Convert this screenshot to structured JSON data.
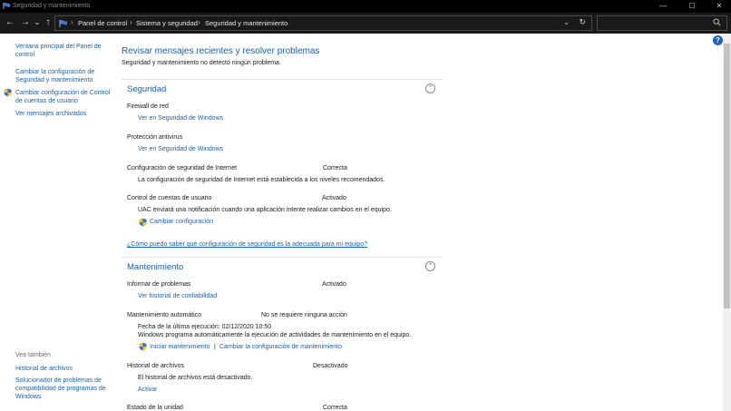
{
  "window": {
    "title": "Seguridad y mantenimiento",
    "minimize": "—",
    "maximize": "☐",
    "close": "✕"
  },
  "nav": {
    "back": "←",
    "forward": "→",
    "recent": "⌄",
    "up": "↑"
  },
  "breadcrumb": [
    "Panel de control",
    "Sistema y seguridad",
    "Seguridad y mantenimiento"
  ],
  "search": {
    "placeholder": ""
  },
  "sidebar": {
    "links": [
      "Ventana principal del Panel de control",
      "Cambiar la configuración de Seguridad y mantenimiento",
      "Cambiar configuración de Control de cuentas de usuario",
      "Ver mensajes archivados"
    ],
    "see_also_heading": "Vea también",
    "see_also": [
      "Historial de archivos",
      "Solucionador de problemas de compatibilidad de programas de Windows"
    ]
  },
  "header": {
    "title": "Revisar mensajes recientes y resolver problemas",
    "subtitle": "Seguridad y mantenimiento no detectó ningún problema."
  },
  "security": {
    "title": "Seguridad",
    "firewall": {
      "label": "Firewall de red",
      "link": "Ver en Seguridad de Windows"
    },
    "antivirus": {
      "label": "Protección antivirus",
      "link": "Ver en Seguridad de Windows"
    },
    "internet": {
      "label": "Configuración de seguridad de Internet",
      "status": "Correcta",
      "desc": "La configuración de seguridad de Internet está establecida a los niveles recomendados."
    },
    "uac": {
      "label": "Control de cuentas de usuario",
      "status": "Activado",
      "desc": "UAC enviará una notificación cuando una aplicación intente realizar cambios en el equipo.",
      "link": "Cambiar configuración"
    },
    "question_link": "¿Cómo puedo saber qué configuración de seguridad es la adecuada para mi equipo?"
  },
  "maintenance": {
    "title": "Mantenimiento",
    "problems": {
      "label": "Informar de problemas",
      "status": "Activado",
      "link": "Ver historial de confiabilidad"
    },
    "automatic": {
      "label": "Mantenimiento automático",
      "status": "No se requiere ninguna acción",
      "last_run": "Fecha de la última ejecución: 02/12/2020 10:50",
      "desc": "Windows programa automáticamente la ejecución de actividades de mantenimiento en el equipo.",
      "start_link": "Iniciar mantenimiento",
      "separator": "|",
      "change_link": "Cambiar la configuración de mantenimiento"
    },
    "file_history": {
      "label": "Historial de archivos",
      "status": "Desactivado",
      "desc": "El historial de archivos está desactivado.",
      "link": "Activar"
    },
    "drive_status": {
      "label": "Estado de la unidad",
      "status": "Correcta"
    }
  },
  "help_label": "?",
  "colors": {
    "link": "#1c5fa8",
    "titlebar": "#000000",
    "addressbar": "#1a1a1a"
  }
}
